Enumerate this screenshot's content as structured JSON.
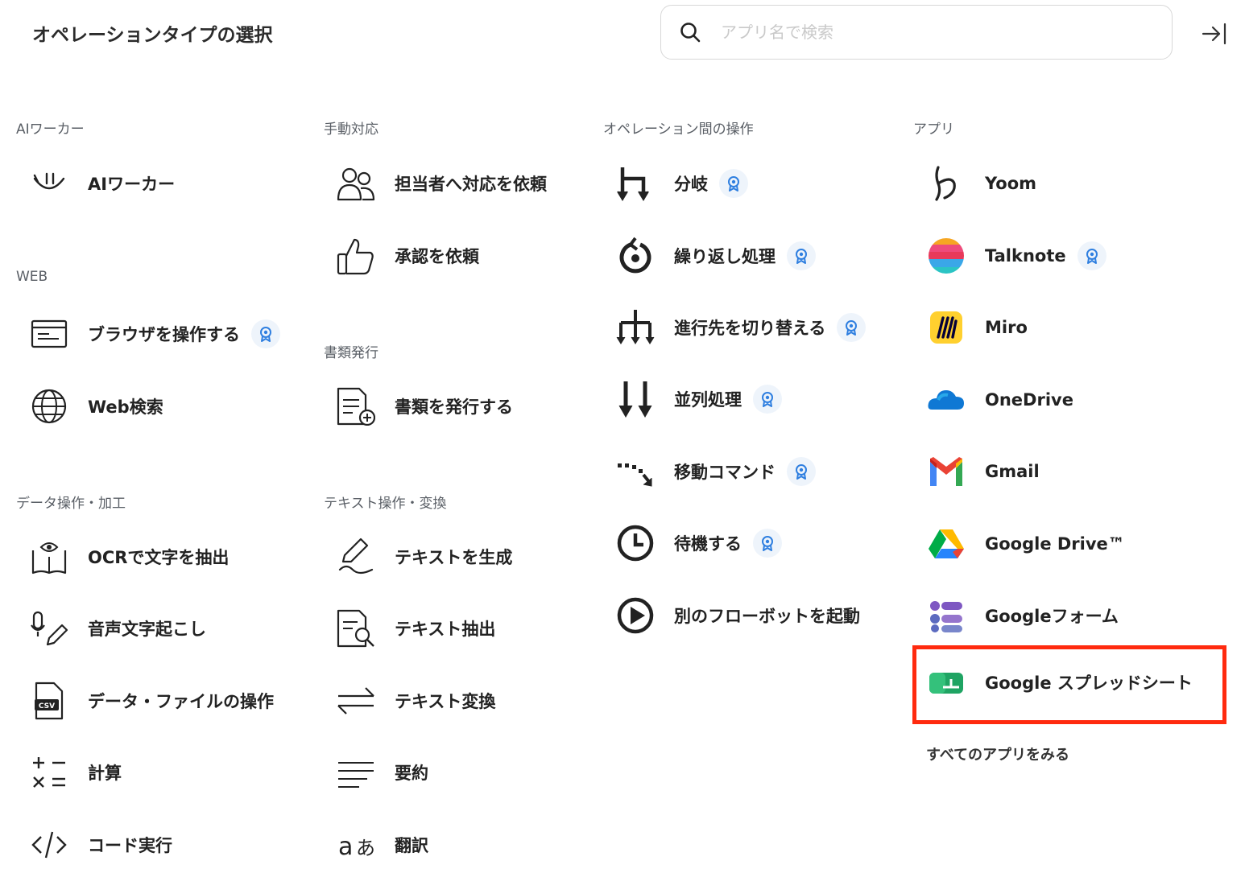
{
  "header": {
    "title": "オペレーションタイプの選択",
    "search_placeholder": "アプリ名で検索"
  },
  "sections": {
    "ai_worker": "AIワーカー",
    "web": "WEB",
    "data_ops": "データ操作・加工",
    "manual": "手動対応",
    "documents": "書類発行",
    "text_ops": "テキスト操作・変換",
    "flow_ops": "オペレーション間の操作",
    "apps": "アプリ"
  },
  "items": {
    "ai_worker": "AIワーカー",
    "browser": "ブラウザを操作する",
    "web_search": "Web検索",
    "ocr": "OCRで文字を抽出",
    "transcribe": "音声文字起こし",
    "data_file": "データ・ファイルの操作",
    "calc": "計算",
    "code": "コード実行",
    "request_assignee": "担当者へ対応を依頼",
    "request_approval": "承認を依頼",
    "issue_document": "書類を発行する",
    "generate_text": "テキストを生成",
    "extract_text": "テキスト抽出",
    "convert_text": "テキスト変換",
    "summarize": "要約",
    "translate": "翻訳",
    "branch": "分岐",
    "loop": "繰り返し処理",
    "switch_path": "進行先を切り替える",
    "parallel": "並列処理",
    "move_command": "移動コマンド",
    "wait": "待機する",
    "start_flowbot": "別のフローボットを起動"
  },
  "apps": {
    "yoom": "Yoom",
    "talknote": "Talknote",
    "miro": "Miro",
    "onedrive": "OneDrive",
    "gmail": "Gmail",
    "google_drive": "Google Drive™",
    "google_form": "Googleフォーム",
    "google_sheets": "Google スプレッドシート",
    "see_all": "すべてのアプリをみる"
  },
  "colors": {
    "highlight": "#ff2a0f",
    "badge_blue": "#2f7fe0",
    "badge_bg": "#eef4fb"
  }
}
